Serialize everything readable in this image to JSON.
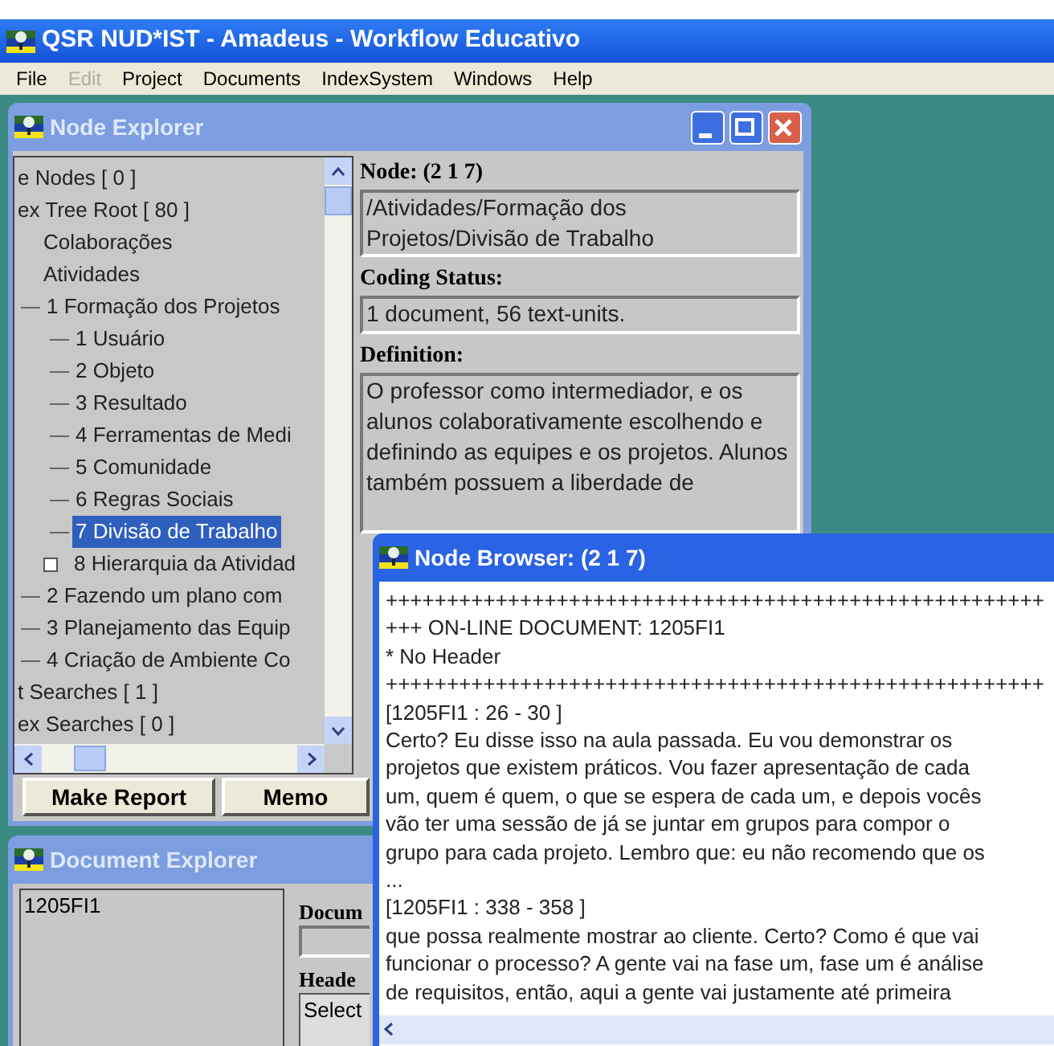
{
  "window": {
    "title": "QSR NUD*IST - Amadeus - Workflow Educativo"
  },
  "menu": [
    {
      "label": "File",
      "disabled": false
    },
    {
      "label": "Edit",
      "disabled": true
    },
    {
      "label": "Project",
      "disabled": false
    },
    {
      "label": "Documents",
      "disabled": false
    },
    {
      "label": "IndexSystem",
      "disabled": false
    },
    {
      "label": "Windows",
      "disabled": false
    },
    {
      "label": "Help",
      "disabled": false
    }
  ],
  "node_explorer": {
    "title": "Node Explorer",
    "tree": [
      {
        "label": "e Nodes [ 0 ]",
        "selected": false,
        "collapsed": false
      },
      {
        "label": "ex Tree Root [ 80 ]",
        "selected": false,
        "collapsed": false,
        "children": [
          {
            "label": "Colaborações",
            "selected": false,
            "collapsed": false
          },
          {
            "label": "Atividades",
            "selected": false,
            "collapsed": false,
            "children": [
              {
                "label": "1  Formação dos Projetos",
                "selected": false,
                "collapsed": false,
                "children": [
                  {
                    "label": "1  Usuário",
                    "selected": false,
                    "collapsed": false
                  },
                  {
                    "label": "2  Objeto",
                    "selected": false,
                    "collapsed": false
                  },
                  {
                    "label": "3  Resultado",
                    "selected": false,
                    "collapsed": false
                  },
                  {
                    "label": "4  Ferramentas de Medi",
                    "selected": false,
                    "collapsed": false
                  },
                  {
                    "label": "5  Comunidade",
                    "selected": false,
                    "collapsed": false
                  },
                  {
                    "label": "6  Regras Sociais",
                    "selected": false,
                    "collapsed": false
                  },
                  {
                    "label": "7  Divisão de Trabalho",
                    "selected": true,
                    "collapsed": false
                  },
                  {
                    "label": "8  Hierarquia da Atividad",
                    "selected": false,
                    "collapsed": true
                  }
                ]
              },
              {
                "label": "2  Fazendo um plano com",
                "selected": false,
                "collapsed": false
              },
              {
                "label": "3  Planejamento das Equip",
                "selected": false,
                "collapsed": false
              },
              {
                "label": "4  Criação de Ambiente Co",
                "selected": false,
                "collapsed": false
              }
            ]
          }
        ]
      },
      {
        "label": "t Searches [ 1 ]",
        "selected": false,
        "collapsed": false
      },
      {
        "label": "ex Searches [ 0 ]",
        "selected": false,
        "collapsed": false
      }
    ],
    "buttons": [
      "Make Report",
      "Memo"
    ],
    "node_label": "Node: (2 1 7)",
    "node_path": "/Atividades/Formação dos Projetos/Divisão de Trabalho",
    "coding_status_label": "Coding Status:",
    "coding_status": "1 document, 56 text-units.",
    "definition_label": "Definition:",
    "definition": "O professor como intermediador, e os alunos colaborativamente escolhendo e definindo as equipes e os projetos. Alunos também possuem a liberdade de"
  },
  "node_browser": {
    "title": "Node Browser: (2 1 7)",
    "lines": [
      "++++++++++++++++++++++++++++++++++++++++++++++++++++++",
      "+++ ON-LINE DOCUMENT: 1205FI1",
      "* No Header",
      "++++++++++++++++++++++++++++++++++++++++++++++++++++++",
      "[1205FI1 : 26 - 30 ]",
      "Certo? Eu disse isso na aula passada. Eu vou demonstrar os",
      "projetos que existem práticos. Vou fazer apresentação de cada",
      "um, quem é quem, o que se espera de cada um, e depois vocês",
      "vão ter uma sessão de já se juntar em grupos para compor o",
      "grupo para cada projeto. Lembro que: eu não recomendo que os",
      "...",
      "[1205FI1 : 338 - 358 ]",
      "que possa realmente mostrar ao cliente. Certo?  Como é que vai",
      "funcionar o processo? A gente vai na fase um, fase um é análise",
      "de requisitos, então, aqui a gente vai justamente até primeira"
    ]
  },
  "document_explorer": {
    "title": "Document Explorer",
    "documents": [
      "1205FI1"
    ],
    "document_label": "Docum",
    "header_label": "Heade",
    "header_select": "Select"
  }
}
